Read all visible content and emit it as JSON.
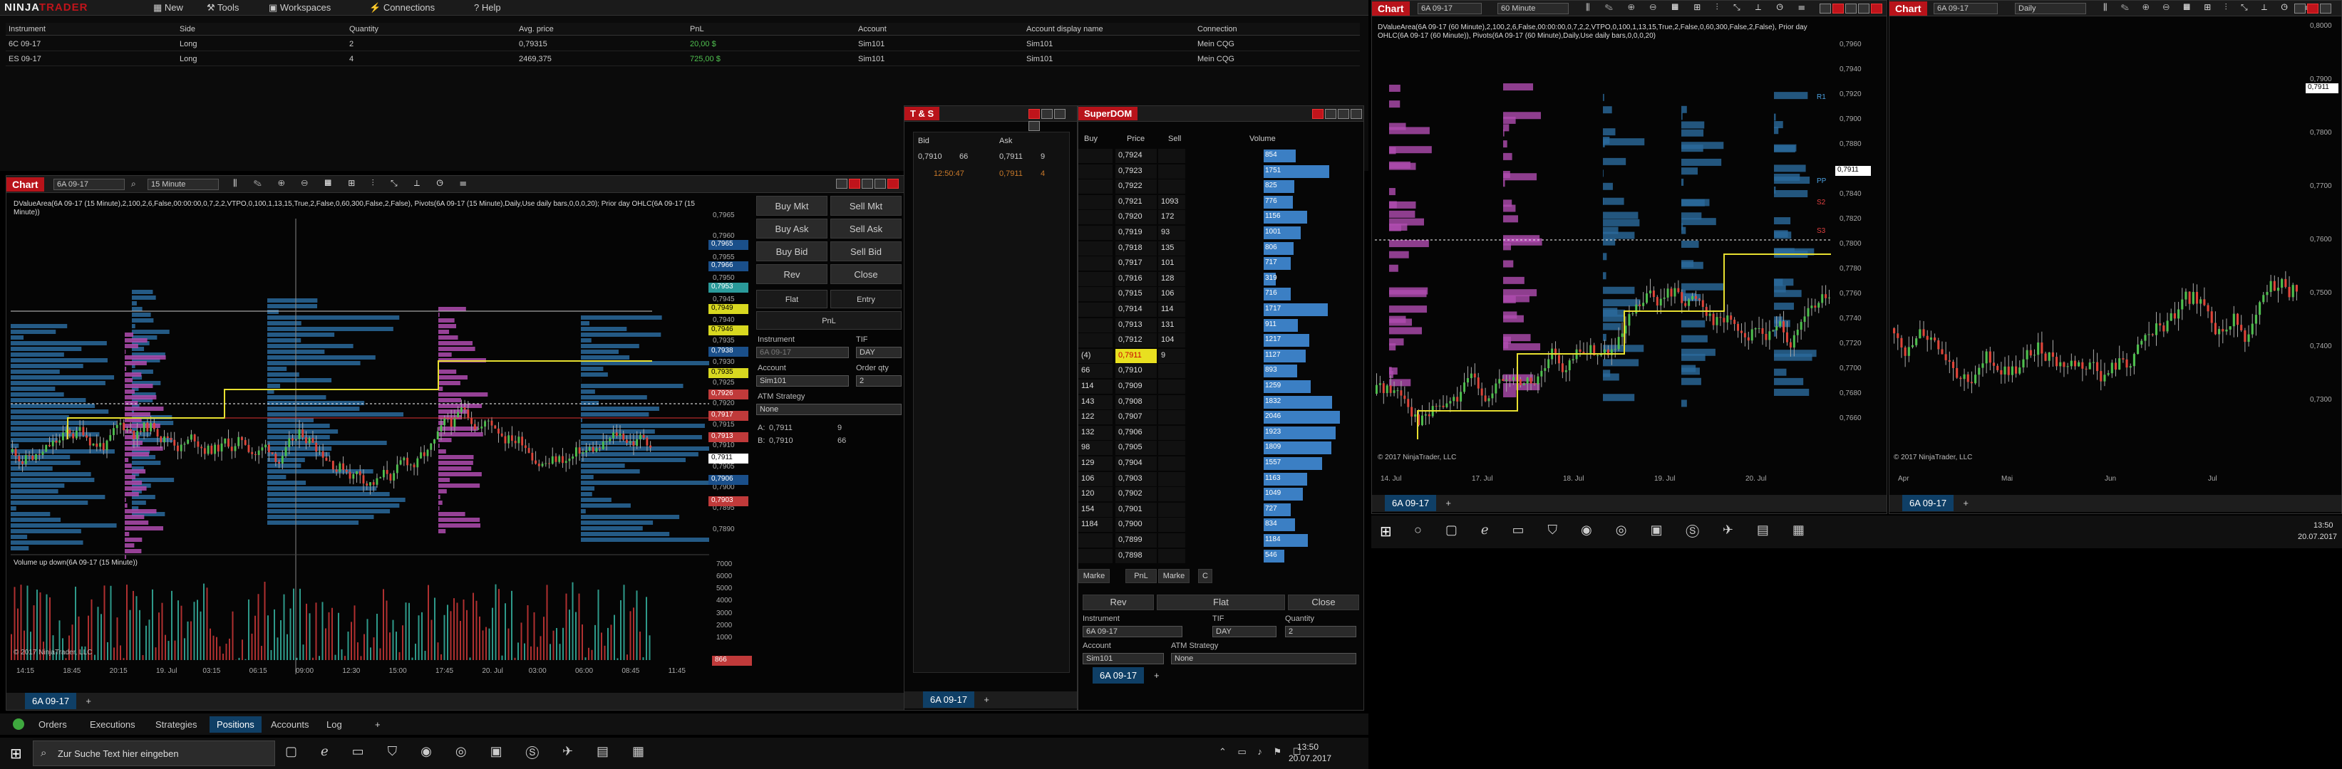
{
  "control_center": {
    "menu": [
      "New",
      "Tools",
      "Workspaces",
      "Connections",
      "Help"
    ],
    "columns": [
      "Instrument",
      "Side",
      "Quantity",
      "Avg. price",
      "PnL",
      "Account",
      "Account display name",
      "Connection"
    ],
    "rows": [
      [
        "6C 09-17",
        "Long",
        "2",
        "0,79315",
        "20,00 $",
        "Sim101",
        "Sim101",
        "Mein CQG"
      ],
      [
        "ES 09-17",
        "Long",
        "4",
        "2469,375",
        "725,00 $",
        "Sim101",
        "Sim101",
        "Mein CQG"
      ]
    ],
    "bottom_tabs": [
      "Orders",
      "Executions",
      "Strategies",
      "Positions",
      "Accounts",
      "Log"
    ]
  },
  "chart1": {
    "title": "Chart",
    "instrument": "6A 09-17",
    "interval": "15 Minute",
    "caption": "DValueArea(6A 09-17 (15 Minute),2,100,2,6,False,00:00:00,0,7,2,2,VTPO,0,100,1,13,15,True,2,False,0,60,300,False,2,False), Pivots(6A 09-17 (15 Minute),Daily,Use daily bars,0,0,0,20); Prior day OHLC(6A 09-17 (15 Minute))",
    "volume_caption": "Volume up down(6A 09-17 (15 Minute))",
    "copyright": "© 2017 NinjaTrader, LLC",
    "price_ticks": [
      "0,7965",
      "0,7960",
      "0,7955",
      "0,7950",
      "0,7945",
      "0,7940",
      "0,7935",
      "0,7930",
      "0,7925",
      "0,7920",
      "0,7915",
      "0,7910",
      "0,7905",
      "0,7900",
      "0,7895",
      "0,7890"
    ],
    "price_tags": [
      "0,7965",
      "0,7966",
      "0,7953",
      "0,7949",
      "0,7946",
      "0,7938",
      "0,7935",
      "0,7926",
      "0,7917",
      "0,7913",
      "0,7911",
      "0,7906",
      "0,7903"
    ],
    "vol_ticks": [
      "7000",
      "6000",
      "5000",
      "4000",
      "3000",
      "2000",
      "1000"
    ],
    "vol_tag": "866",
    "time_ticks": [
      "14:15",
      "18:45",
      "20:15",
      "19. Jul",
      "03:15",
      "06:15",
      "09:00",
      "12:30",
      "15:00",
      "17:45",
      "20. Jul",
      "03:00",
      "06:00",
      "08:45",
      "11:45"
    ],
    "chart_trader": {
      "buy_mkt": "Buy Mkt",
      "sell_mkt": "Sell Mkt",
      "buy_ask": "Buy Ask",
      "sell_ask": "Sell Ask",
      "buy_bid": "Buy Bid",
      "sell_bid": "Sell Bid",
      "rev": "Rev",
      "close": "Close",
      "flat": "Flat",
      "entry": "Entry",
      "pnl": "PnL",
      "instrument_label": "Instrument",
      "instrument": "6A 09-17",
      "tif_label": "TIF",
      "tif": "DAY",
      "account_label": "Account",
      "account": "Sim101",
      "qty_label": "Order qty",
      "qty": "2",
      "atm_label": "ATM Strategy",
      "atm": "None",
      "a_row": [
        "A:",
        "0,7911",
        "9"
      ],
      "b_row": [
        "B:",
        "0,7910",
        "66"
      ]
    },
    "tab": "6A 09-17"
  },
  "ts": {
    "title": "T & S",
    "bid_label": "Bid",
    "ask_label": "Ask",
    "bid": "0,7910",
    "bid_size": "66",
    "ask": "0,7911",
    "ask_size": "9",
    "time": "12:50:47",
    "price": "0,7911",
    "size": "4",
    "tab": "6A 09-17"
  },
  "superdom": {
    "title": "SuperDOM",
    "headers": [
      "Buy",
      "Price",
      "Sell",
      "Volume"
    ],
    "rows": [
      [
        "",
        "0,7924",
        "",
        "854"
      ],
      [
        "",
        "0,7923",
        "",
        "1751"
      ],
      [
        "",
        "0,7922",
        "",
        "825"
      ],
      [
        "",
        "0,7921",
        "1093",
        "776"
      ],
      [
        "",
        "0,7920",
        "172",
        "1156"
      ],
      [
        "",
        "0,7919",
        "93",
        "1001"
      ],
      [
        "",
        "0,7918",
        "135",
        "806"
      ],
      [
        "",
        "0,7917",
        "101",
        "717"
      ],
      [
        "",
        "0,7916",
        "128",
        "319"
      ],
      [
        "",
        "0,7915",
        "106",
        "716"
      ],
      [
        "",
        "0,7914",
        "114",
        "1717"
      ],
      [
        "",
        "0,7913",
        "131",
        "911"
      ],
      [
        "",
        "0,7912",
        "104",
        "1217"
      ],
      [
        "(4)",
        "0,7911",
        "9",
        "1127"
      ],
      [
        "66",
        "0,7910",
        "",
        "893"
      ],
      [
        "114",
        "0,7909",
        "",
        "1259"
      ],
      [
        "143",
        "0,7908",
        "",
        "1832"
      ],
      [
        "122",
        "0,7907",
        "",
        "2046"
      ],
      [
        "132",
        "0,7906",
        "",
        "1923"
      ],
      [
        "98",
        "0,7905",
        "",
        "1809"
      ],
      [
        "129",
        "0,7904",
        "",
        "1557"
      ],
      [
        "106",
        "0,7903",
        "",
        "1163"
      ],
      [
        "120",
        "0,7902",
        "",
        "1049"
      ],
      [
        "154",
        "0,7901",
        "",
        "727"
      ],
      [
        "1184",
        "0,7900",
        "",
        "834"
      ],
      [
        "",
        "0,7899",
        "",
        "1184"
      ],
      [
        "",
        "0,7898",
        "",
        "546"
      ]
    ],
    "footer": [
      "Marke",
      "PnL",
      "Marke",
      "C"
    ],
    "rev": "Rev",
    "flat": "Flat",
    "close": "Close",
    "instrument_label": "Instrument",
    "instrument": "6A 09-17",
    "tif_label": "TIF",
    "tif": "DAY",
    "qty_label": "Quantity",
    "qty": "2",
    "account_label": "Account",
    "account": "Sim101",
    "atm_label": "ATM Strategy",
    "atm": "None",
    "tab": "6A 09-17"
  },
  "chart2": {
    "title": "Chart",
    "instrument": "6A 09-17",
    "interval": "60 Minute",
    "caption": "DValueArea(6A 09-17 (60 Minute),2,100,2,6,False,00:00:00,0,7,2,2,VTPO,0,100,1,13,15,True,2,False,0,60,300,False,2,False), Prior day OHLC(6A 09-17 (60 Minute)), Pivots(6A 09-17 (60 Minute),Daily,Use daily bars,0,0,0,20)",
    "copyright": "© 2017 NinjaTrader, LLC",
    "price_ticks": [
      "0,7960",
      "0,7940",
      "0,7920",
      "0,7900",
      "0,7880",
      "0,7860",
      "0,7840",
      "0,7820",
      "0,7800",
      "0,7780",
      "0,7760",
      "0,7740",
      "0,7720",
      "0,7700",
      "0,7680",
      "0,7660"
    ],
    "price_tag": "0,7911",
    "r_labels": [
      "R1",
      "PP",
      "S2",
      "S3"
    ],
    "time_ticks": [
      "14. Jul",
      "17. Jul",
      "18. Jul",
      "19. Jul",
      "20. Jul"
    ],
    "tab": "6A 09-17"
  },
  "chart3": {
    "title": "Chart",
    "instrument": "6A 09-17",
    "interval": "Daily",
    "copyright": "© 2017 NinjaTrader, LLC",
    "price_ticks": [
      "0,8000",
      "0,7900",
      "0,7800",
      "0,7700",
      "0,7600",
      "0,7500",
      "0,7400",
      "0,7300"
    ],
    "price_tag": "0,7911",
    "time_ticks": [
      "Apr",
      "Mai",
      "Jun",
      "Jul"
    ],
    "tab": "6A 09-17"
  },
  "taskbar": {
    "search": "Zur Suche Text hier eingeben",
    "time": "13:50",
    "date": "20.07.2017"
  },
  "colors": {
    "accent": "#b8131a",
    "bull": "#4fc04f",
    "bear": "#e0453a",
    "profile_blue": "#2a6a9c",
    "profile_pink": "#b04cb0"
  }
}
